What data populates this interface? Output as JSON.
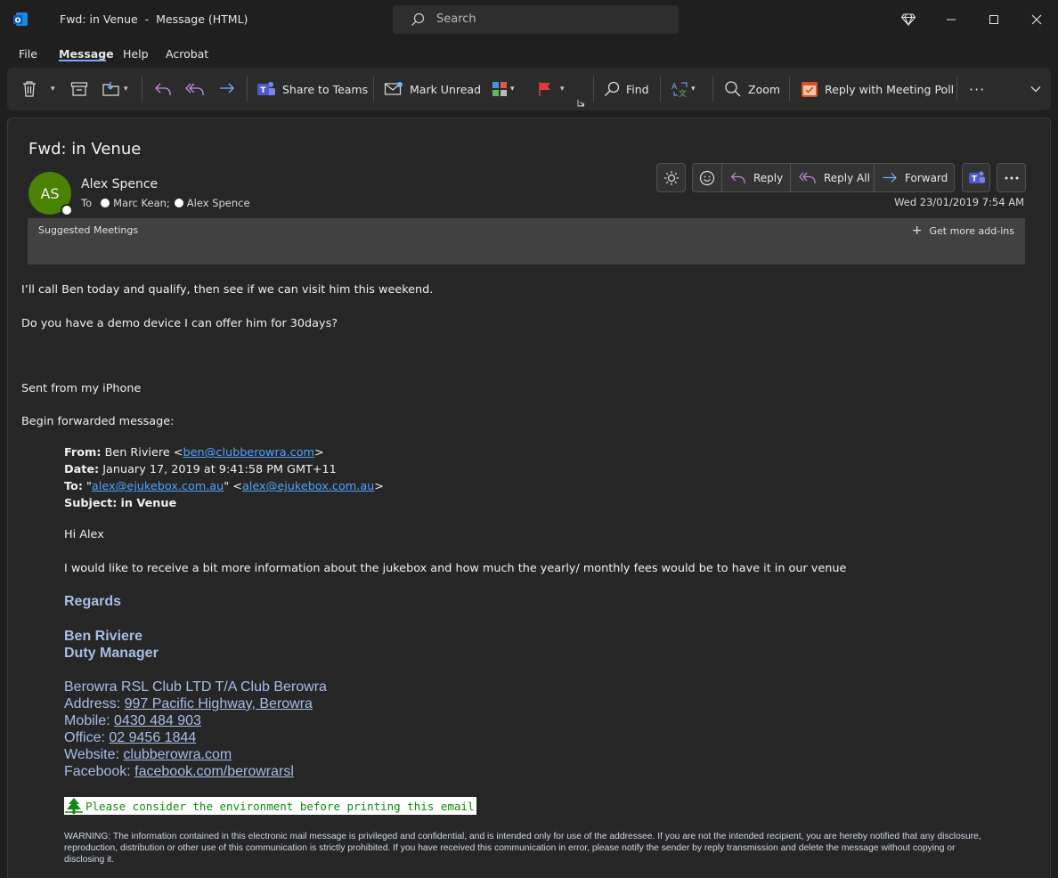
{
  "window": {
    "title": "Fwd: in Venue  -  Message (HTML)",
    "search_placeholder": "Search",
    "icons": [
      "outlook-icon",
      "search-icon",
      "diamond-icon",
      "minimize-icon",
      "maximize-icon",
      "close-icon"
    ]
  },
  "menu": {
    "tabs": [
      {
        "label": "File"
      },
      {
        "label": "Message",
        "active": true
      },
      {
        "label": "Help"
      },
      {
        "label": "Acrobat"
      }
    ]
  },
  "ribbon": {
    "share_to_teams": "Share to Teams",
    "mark_unread": "Mark Unread",
    "find": "Find",
    "zoom": "Zoom",
    "reply_meeting_poll": "Reply with Meeting Poll",
    "more": "···"
  },
  "message": {
    "subject": "Fwd: in Venue",
    "sender_initials": "AS",
    "sender_name": "Alex Spence",
    "to_label": "To",
    "recipients": [
      "Marc Kean;",
      "Alex Spence"
    ],
    "date": "Wed 23/01/2019 7:54 AM",
    "actions": {
      "reply": "Reply",
      "reply_all": "Reply All",
      "forward": "Forward"
    },
    "suggested_meetings": "Suggested Meetings",
    "get_addins": "Get more add-ins"
  },
  "body": {
    "line1": "I’ll call Ben today and qualify, then see if we can visit him this weekend.",
    "line2": "Do you have a demo device I can offer him for 30days?",
    "line3": "Sent from my iPhone",
    "line4": "Begin forwarded message:",
    "forwarded": {
      "from_label": "From:",
      "from_name": "Ben Riviere <",
      "from_email": "ben@clubberowra.com",
      "from_close": ">",
      "date_label": "Date:",
      "date_value": "January 17, 2019 at 9:41:58 PM GMT+11",
      "to_label": "To:",
      "to_quote_open": "\"",
      "to_email_1": "alex@ejukebox.com.au",
      "to_quote_close": "\" <",
      "to_email_2": "alex@ejukebox.com.au",
      "to_close": ">",
      "subject_label": "Subject:",
      "subject_value": "in Venue",
      "greeting": "Hi Alex",
      "text": "I would like to receive a bit more information about the jukebox and how much the yearly/ monthly fees would be to have it in our venue"
    },
    "signature": {
      "regards": "Regards",
      "name": "Ben Riviere",
      "title": "Duty Manager",
      "org": "Berowra RSL Club LTD T/A Club Berowra",
      "address_label": "Address: ",
      "address": "997 Pacific Highway, Berowra",
      "mobile_label": "Mobile: ",
      "mobile": "0430 484 903",
      "office_label": "Office: ",
      "office": "02 9456 1844",
      "website_label": "Website: ",
      "website": "clubberowra.com",
      "facebook_label": "Facebook: ",
      "facebook": "facebook.com/berowrarsl"
    },
    "eco_note": "Please consider the environment before printing this email",
    "warning": "WARNING: The information contained in this electronic mail message is privileged and confidential, and is intended only for use of the addressee. If you are not the intended recipient, you are hereby notified that any disclosure, reproduction, distribution or other use of this communication is strictly prohibited. If you have received this communication in error, please notify the sender by reply transmission and delete the message without copying or disclosing it."
  },
  "colors": {
    "background": "#1f1f1f",
    "panel": "#262626",
    "accent": "#7aa7ff",
    "link": "#4da3ff",
    "avatar": "#498205",
    "signature": "#a6bde8",
    "eco_green": "#108a10"
  }
}
